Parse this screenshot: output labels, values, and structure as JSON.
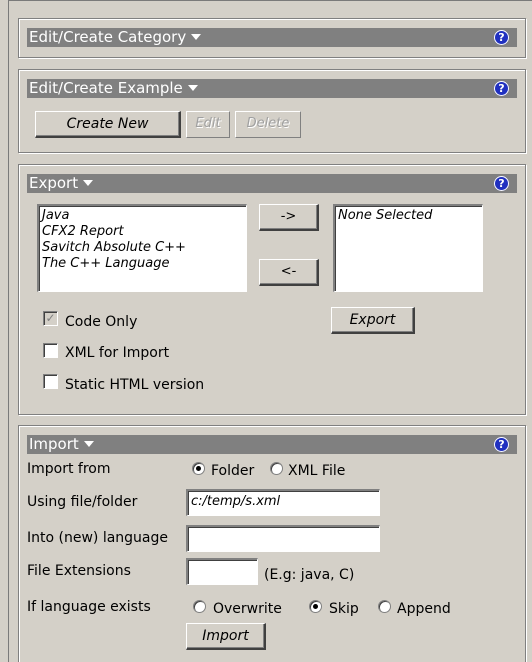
{
  "category_panel": {
    "title": "Edit/Create Category",
    "help": "?"
  },
  "example_panel": {
    "title": "Edit/Create Example",
    "help": "?",
    "create_new_label": "Create New",
    "edit_label": "Edit",
    "delete_label": "Delete"
  },
  "export_panel": {
    "title": "Export",
    "help": "?",
    "available_items": [
      "Java",
      "CFX2 Report",
      "Savitch Absolute C++",
      "The C++ Language"
    ],
    "selected_items": [
      "None Selected"
    ],
    "move_right_label": "->",
    "move_left_label": "<-",
    "export_button_label": "Export",
    "options": [
      {
        "label": "Code Only",
        "checked": true,
        "disabled": true
      },
      {
        "label": "XML for Import",
        "checked": false,
        "disabled": false
      },
      {
        "label": "Static HTML version",
        "checked": false,
        "disabled": false
      }
    ]
  },
  "import_panel": {
    "title": "Import",
    "help": "?",
    "import_from_label": "Import from",
    "source_options": [
      {
        "label": "Folder",
        "checked": true
      },
      {
        "label": "XML File",
        "checked": false
      }
    ],
    "file_label": "Using file/folder",
    "file_value": "c:/temp/s.xml",
    "language_label": "Into (new) language",
    "language_value": "",
    "extensions_label": "File Extensions",
    "extensions_value": "",
    "extensions_hint": "(E.g: java, C)",
    "exists_label": "If language exists",
    "exists_options": [
      {
        "label": "Overwrite",
        "checked": false
      },
      {
        "label": "Skip",
        "checked": true
      },
      {
        "label": "Append",
        "checked": false
      }
    ],
    "import_button_label": "Import"
  }
}
